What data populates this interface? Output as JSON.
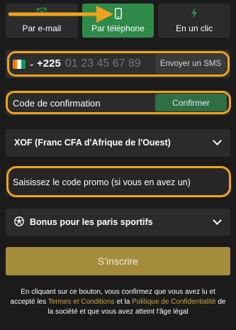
{
  "tabs": [
    {
      "label": "Par e-mail",
      "icon": "email-icon",
      "active": false
    },
    {
      "label": "Par téléphone",
      "icon": "phone-icon",
      "active": true
    },
    {
      "label": "En un clic",
      "icon": "lightning-icon",
      "active": false
    }
  ],
  "phone": {
    "country_code": "+225",
    "placeholder": "01 23 45 67 89",
    "send_sms_label": "Envoyer un SMS",
    "flag_colors": [
      "#f77f00",
      "#ffffff",
      "#009e60"
    ]
  },
  "confirmation": {
    "label": "Code de confirmation",
    "confirm_label": "Confirmer"
  },
  "currency": {
    "selected": "XOF (Franc CFA d'Afrique de l'Ouest)"
  },
  "promo": {
    "placeholder": "Saisissez le code promo (si vous en avez un)"
  },
  "bonus": {
    "label": "Bonus pour les paris sportifs",
    "icon": "soccer-ball-icon"
  },
  "submit": {
    "label": "S'inscrire"
  },
  "terms": {
    "part1": "En cliquant sur ce bouton, vous confirmez que vous avez lu et accepté les",
    "link1": "Termes et Conditions",
    "and": "et la",
    "link2": "Politique de Confidentialité",
    "part2": "de la société et que vous avez atteint l'âge légal"
  },
  "colors": {
    "accent_green": "#2f8a4a",
    "highlight_orange": "#f0a21c",
    "submit_gold": "#a58c3c",
    "link_gold": "#c9a645"
  }
}
